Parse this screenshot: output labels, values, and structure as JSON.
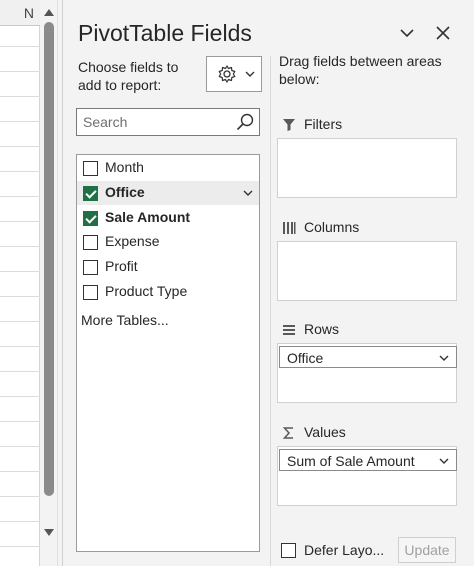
{
  "sheet": {
    "column_header": "N"
  },
  "panel": {
    "title": "PivotTable Fields",
    "choose_label": "Choose fields to add to report:",
    "search": {
      "placeholder": "Search",
      "value": ""
    },
    "fields": [
      {
        "label": "Month",
        "checked": false,
        "bold": false
      },
      {
        "label": "Office",
        "checked": true,
        "bold": true
      },
      {
        "label": "Sale Amount",
        "checked": true,
        "bold": true
      },
      {
        "label": "Expense",
        "checked": false,
        "bold": false
      },
      {
        "label": "Profit",
        "checked": false,
        "bold": false
      },
      {
        "label": "Product Type",
        "checked": false,
        "bold": false
      }
    ],
    "more_tables": "More Tables...",
    "drag_label": "Drag fields between areas below:",
    "areas": {
      "filters": {
        "title": "Filters",
        "items": []
      },
      "columns": {
        "title": "Columns",
        "items": []
      },
      "rows": {
        "title": "Rows",
        "items": [
          "Office"
        ]
      },
      "values": {
        "title": "Values",
        "items": [
          "Sum of Sale Amount"
        ]
      }
    },
    "defer_layout": {
      "label": "Defer Layo...",
      "checked": false
    },
    "update_button": "Update"
  },
  "colors": {
    "check_green": "#1f7145",
    "panel_bg": "#f3f3f3",
    "scroll_thumb": "#8a8a8a"
  }
}
